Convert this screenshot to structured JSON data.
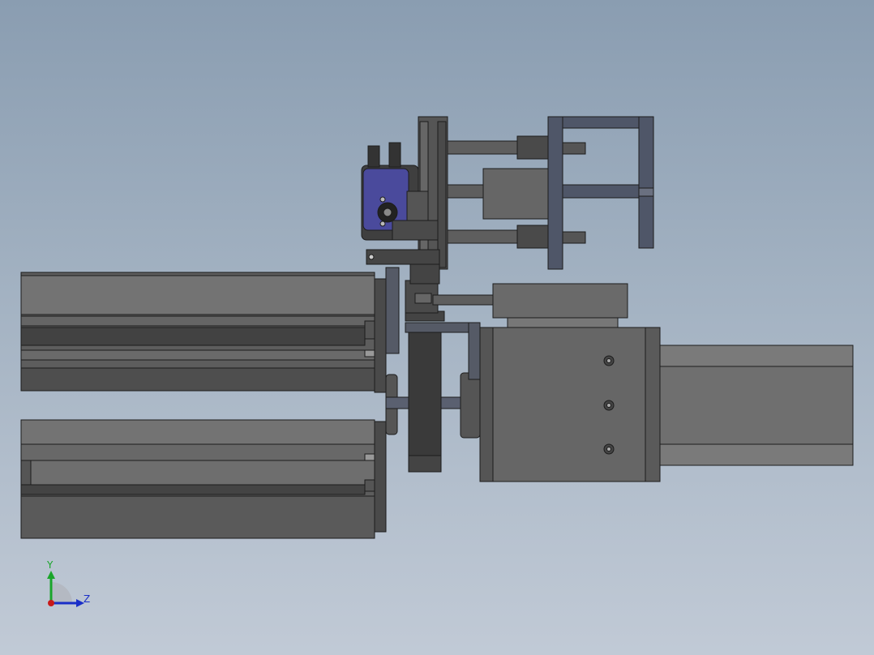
{
  "triad": {
    "y_label": "Y",
    "z_label": "Z",
    "y_color": "#1aa52a",
    "z_color": "#1a2fc8",
    "x_color": "#c81a1a"
  },
  "palette": {
    "body_dark": "#3c3c3c",
    "body_mid": "#5a5a5a",
    "body_light": "#737373",
    "edge": "#1c1c1c",
    "bracket_blue": "#4f5668",
    "gripper_blue": "#4a4a9c"
  }
}
